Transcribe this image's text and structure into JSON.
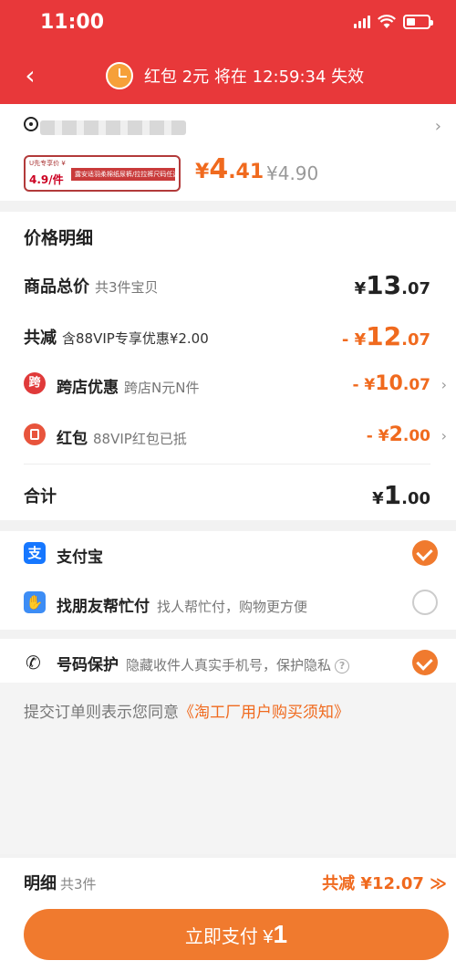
{
  "status_bar": {
    "time": "11:00"
  },
  "header": {
    "back_glyph": "‹",
    "countdown_text": "红包 2元 将在 12:59:34 失效"
  },
  "product": {
    "address_chevron": "›",
    "thumb_tag": "U先专享价 ¥",
    "thumb_num": "4.9/件",
    "thumb_band": "露安适羽柔棉纸尿裤/拉拉裤尺码任选",
    "price_currency": "¥",
    "price_int": "4",
    "price_dec": ".41",
    "price_old": "¥4.90"
  },
  "price_detail": {
    "title": "价格明细",
    "goods_total": {
      "label": "商品总价",
      "sub": "共3件宝贝",
      "cur": "¥",
      "int": "13",
      "dec": ".07"
    },
    "total_reduction": {
      "label": "共减",
      "sub": "含88VIP专享优惠¥2.00",
      "cur": "- ¥",
      "int": "12",
      "dec": ".07"
    },
    "cross_store": {
      "icon": "跨",
      "label": "跨店优惠",
      "sub": "跨店N元N件",
      "cur": "- ¥",
      "int": "10",
      "dec": ".07",
      "chevron": "›"
    },
    "red_packet": {
      "label": "红包",
      "sub": "88VIP红包已抵",
      "cur": "- ¥",
      "int": "2",
      "dec": ".00",
      "chevron": "›"
    },
    "subtotal": {
      "label": "合计",
      "cur": "¥",
      "int": "1",
      "dec": ".00"
    }
  },
  "payment": {
    "alipay": {
      "icon": "支",
      "label": "支付宝",
      "checked": true
    },
    "friend_pay": {
      "icon": "✋",
      "label": "找朋友帮忙付",
      "sub": "找人帮忙付，购物更方便",
      "checked": false
    }
  },
  "protection": {
    "label": "号码保护",
    "sub": "隐藏收件人真实手机号，保护隐私",
    "help": "?",
    "checked": true,
    "agree_prefix": "提交订单则表示您同意",
    "agree_link": "《淘工厂用户购买须知》"
  },
  "bottom": {
    "label": "明细",
    "count": "共3件",
    "discount": "共减 ¥12.07 ≫",
    "pay_label": "立即支付 ¥",
    "pay_amount": "1"
  },
  "colors": {
    "brand_red": "#e8383a",
    "accent_orange": "#f06a1e"
  }
}
